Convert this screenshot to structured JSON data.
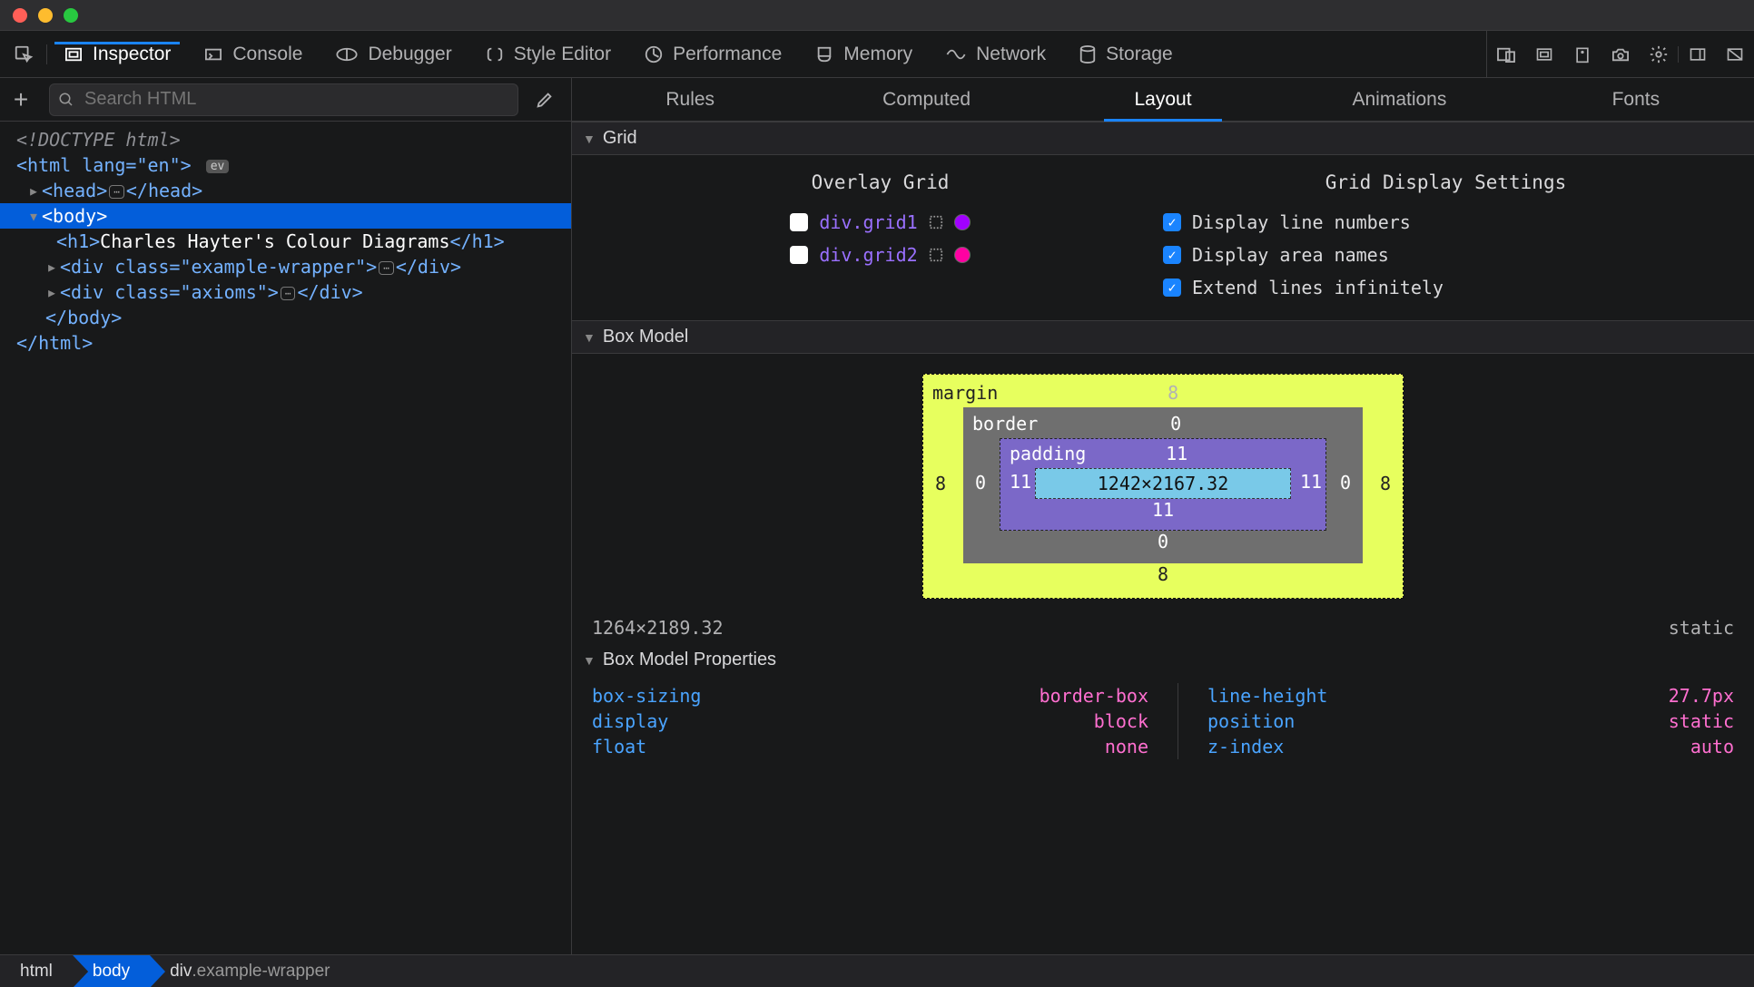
{
  "toolbar": {
    "tabs": [
      "Inspector",
      "Console",
      "Debugger",
      "Style Editor",
      "Performance",
      "Memory",
      "Network",
      "Storage"
    ],
    "active": 0
  },
  "search": {
    "placeholder": "Search HTML"
  },
  "tree": {
    "doctype": "<!DOCTYPE html>",
    "html_open": "<html lang=\"en\">",
    "ev_badge": "ev",
    "head": "<head>",
    "head_close": "</head>",
    "body": "<body>",
    "h1_open": "<h1>",
    "h1_text": "Charles Hayter's Colour Diagrams",
    "h1_close": "</h1>",
    "div1": "<div class=\"example-wrapper\">",
    "div_close": "</div>",
    "div2": "<div class=\"axioms\">",
    "body_close": "</body>",
    "html_close": "</html>"
  },
  "rightTabs": {
    "items": [
      "Rules",
      "Computed",
      "Layout",
      "Animations",
      "Fonts"
    ],
    "active": 2
  },
  "sections": {
    "grid": "Grid",
    "boxmodel": "Box Model",
    "props": "Box Model Properties"
  },
  "grid": {
    "overlay_title": "Overlay Grid",
    "settings_title": "Grid Display Settings",
    "items": [
      {
        "name": "div.grid1",
        "color": "#a100ff"
      },
      {
        "name": "div.grid2",
        "color": "#ff00a2"
      }
    ],
    "settings": [
      "Display line numbers",
      "Display area names",
      "Extend lines infinitely"
    ]
  },
  "box": {
    "margin_label": "margin",
    "border_label": "border",
    "padding_label": "padding",
    "margin": {
      "t": "8",
      "r": "8",
      "b": "8",
      "l": "8"
    },
    "border": {
      "t": "0",
      "r": "0",
      "b": "0",
      "l": "0"
    },
    "padding": {
      "t": "11",
      "r": "11",
      "b": "11",
      "l": "11"
    },
    "content": "1242×2167.32",
    "total": "1264×2189.32",
    "position": "static"
  },
  "props": {
    "left": [
      {
        "k": "box-sizing",
        "v": "border-box"
      },
      {
        "k": "display",
        "v": "block"
      },
      {
        "k": "float",
        "v": "none"
      }
    ],
    "right": [
      {
        "k": "line-height",
        "v": "27.7px"
      },
      {
        "k": "position",
        "v": "static"
      },
      {
        "k": "z-index",
        "v": "auto"
      }
    ]
  },
  "crumbs": [
    {
      "label": "html",
      "class": ""
    },
    {
      "label": "body",
      "class": ""
    },
    {
      "label": "div",
      "class": ".example-wrapper"
    }
  ],
  "crumb_active": 1
}
